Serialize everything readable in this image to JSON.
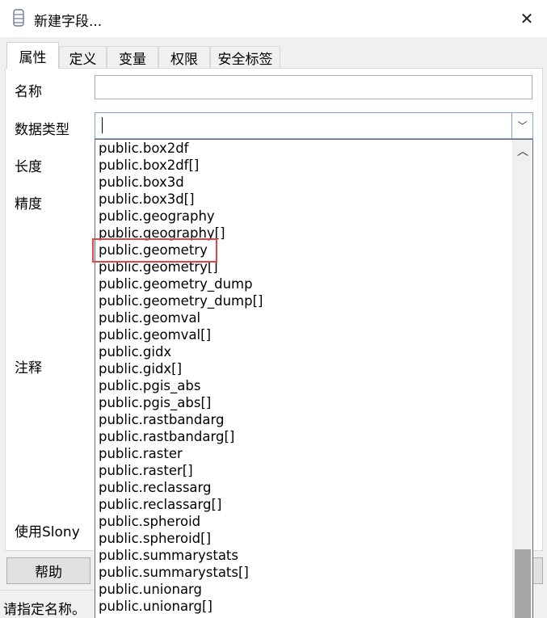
{
  "window": {
    "title": "新建字段...",
    "close_glyph": "✕",
    "app_icon": "database-icon"
  },
  "tabs": [
    {
      "label": "属性",
      "active": true
    },
    {
      "label": "定义",
      "active": false
    },
    {
      "label": "变量",
      "active": false
    },
    {
      "label": "权限",
      "active": false
    },
    {
      "label": "安全标签",
      "active": false
    }
  ],
  "form": {
    "name_label": "名称",
    "name_value": "",
    "datatype_label": "数据类型",
    "datatype_value": "",
    "length_label": "长度",
    "precision_label": "精度",
    "comment_label": "注释",
    "slony_label": "使用Slony"
  },
  "dropdown": {
    "items": [
      "public.box2df",
      "public.box2df[]",
      "public.box3d",
      "public.box3d[]",
      "public.geography",
      "public.geography[]",
      "public.geometry",
      "public.geometry[]",
      "public.geometry_dump",
      "public.geometry_dump[]",
      "public.geomval",
      "public.geomval[]",
      "public.gidx",
      "public.gidx[]",
      "public.pgis_abs",
      "public.pgis_abs[]",
      "public.rastbandarg",
      "public.rastbandarg[]",
      "public.raster",
      "public.raster[]",
      "public.reclassarg",
      "public.reclassarg[]",
      "public.spheroid",
      "public.spheroid[]",
      "public.summarystats",
      "public.summarystats[]",
      "public.unionarg",
      "public.unionarg[]"
    ],
    "highlighted": "public.geometry",
    "scroll_up_glyph": "︿",
    "drop_glyph": "﹀"
  },
  "footer": {
    "help_label": "帮助",
    "status": "请指定名称。"
  },
  "colors": {
    "highlight_border": "#e04848",
    "focus_border": "#7aa7d8"
  }
}
